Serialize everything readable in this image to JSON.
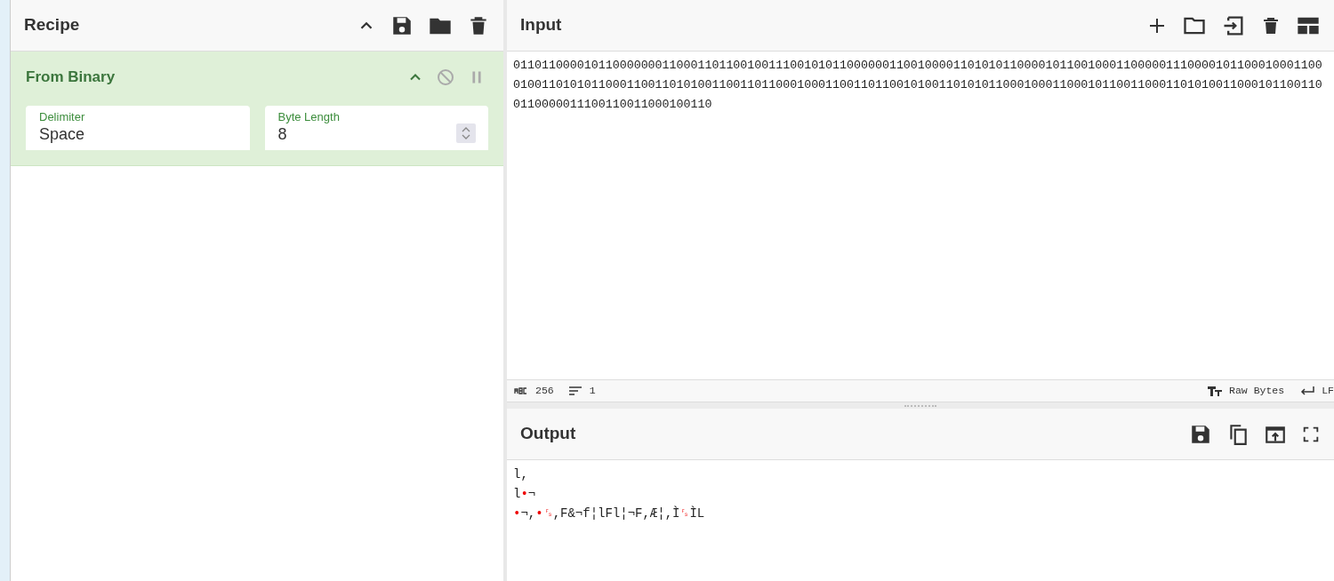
{
  "recipe": {
    "title": "Recipe",
    "operations": [
      {
        "title": "From Binary",
        "expanded": true,
        "disabled": false,
        "paused": false,
        "args": [
          {
            "kind": "text",
            "label": "Delimiter",
            "value": "Space"
          },
          {
            "kind": "number",
            "label": "Byte Length",
            "value": "8"
          }
        ]
      }
    ]
  },
  "input": {
    "title": "Input",
    "value": "0110110000101100000001100011011001001110010101100000011001000011010101100001011001000110000011100001011000100011000100110101011000110011010100110011011000100011001101100101001101010110001000110001011001100011010100110001011001100110000011100110011000100110",
    "status": {
      "length": "256",
      "lines": "1",
      "encoding": "Raw Bytes",
      "eol": "LF"
    }
  },
  "output": {
    "title": "Output",
    "lines": [
      [
        {
          "kind": "text",
          "text": "l,"
        }
      ],
      [
        {
          "kind": "text",
          "text": "l"
        },
        {
          "kind": "control",
          "text": "•"
        },
        {
          "kind": "text",
          "text": "¬"
        }
      ],
      [
        {
          "kind": "control",
          "text": "•"
        },
        {
          "kind": "text",
          "text": "¬,"
        },
        {
          "kind": "control",
          "text": "•"
        },
        {
          "kind": "control",
          "text": "␜"
        },
        {
          "kind": "text",
          "text": ",F&¬f¦lFl¦¬F,Æ¦,Ì"
        },
        {
          "kind": "control",
          "text": "␜"
        },
        {
          "kind": "text",
          "text": "ÌL"
        }
      ]
    ]
  }
}
